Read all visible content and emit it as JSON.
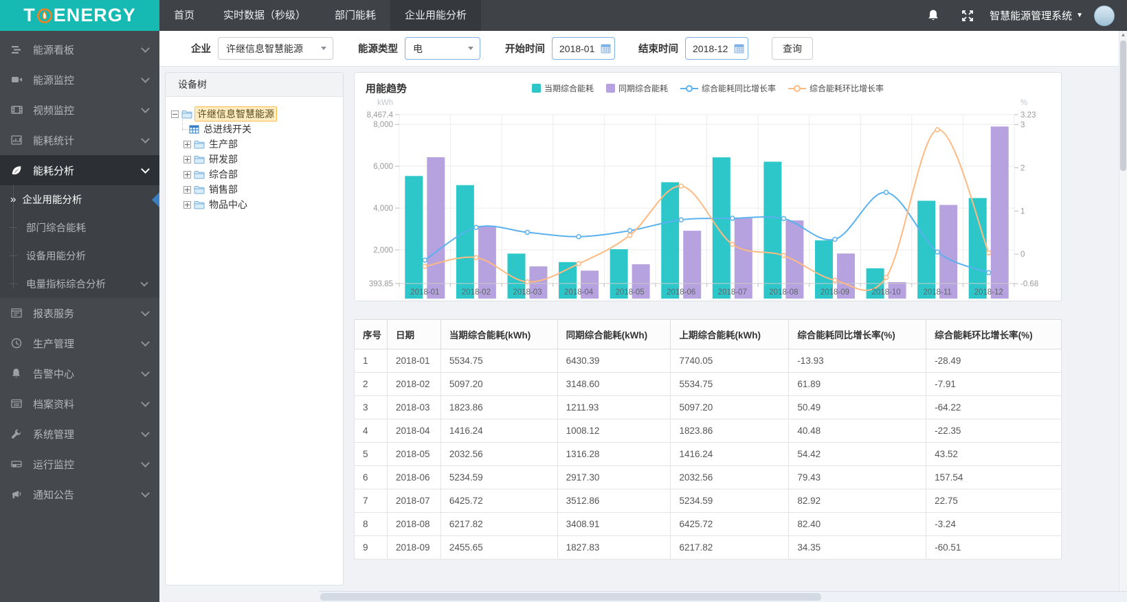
{
  "topbar": {
    "logo": {
      "prefix": "T",
      "suffix": "ENERGY",
      "at_icon": "flame-at-icon"
    },
    "nav": [
      {
        "label": "首页",
        "active": false
      },
      {
        "label": "实时数据（秒级）",
        "active": false
      },
      {
        "label": "部门能耗",
        "active": false
      },
      {
        "label": "企业用能分析",
        "active": true
      }
    ],
    "system_menu": {
      "label": "智慧能源管理系统"
    }
  },
  "sidebar": {
    "items": [
      {
        "label": "能源看板",
        "icon": "dashboard-icon"
      },
      {
        "label": "能源监控",
        "icon": "camera-icon"
      },
      {
        "label": "视频监控",
        "icon": "film-icon"
      },
      {
        "label": "能耗统计",
        "icon": "barchart-icon"
      },
      {
        "label": "能耗分析",
        "icon": "leaf-icon",
        "active": true,
        "expanded": true,
        "children": [
          {
            "label": "企业用能分析",
            "active": true
          },
          {
            "label": "部门综合能耗"
          },
          {
            "label": "设备用能分析"
          },
          {
            "label": "电量指标综合分析",
            "has_children": true
          }
        ]
      },
      {
        "label": "报表服务",
        "icon": "report-icon"
      },
      {
        "label": "生产管理",
        "icon": "clock-icon"
      },
      {
        "label": "告警中心",
        "icon": "bell-icon"
      },
      {
        "label": "档案资料",
        "icon": "archive-icon"
      },
      {
        "label": "系统管理",
        "icon": "wrench-icon"
      },
      {
        "label": "运行监控",
        "icon": "monitor-icon"
      },
      {
        "label": "通知公告",
        "icon": "megaphone-icon"
      }
    ]
  },
  "filters": {
    "company_label": "企业",
    "company_value": "许继信息智慧能源",
    "energy_type_label": "能源类型",
    "energy_type_value": "电",
    "start_label": "开始时间",
    "start_value": "2018-01",
    "end_label": "结束时间",
    "end_value": "2018-12",
    "query_label": "查询"
  },
  "tree": {
    "title": "设备树",
    "nodes": [
      {
        "label": "许继信息智慧能源",
        "icon": "folder-icon",
        "expander": "minus",
        "selected": true,
        "level": 0
      },
      {
        "label": "总进线开关",
        "icon": "meter-table-icon",
        "level": 1,
        "leaf": true
      },
      {
        "label": "生产部",
        "icon": "folder-icon",
        "expander": "plus",
        "level": 1
      },
      {
        "label": "研发部",
        "icon": "folder-icon",
        "expander": "plus",
        "level": 1
      },
      {
        "label": "综合部",
        "icon": "folder-icon",
        "expander": "plus",
        "level": 1
      },
      {
        "label": "销售部",
        "icon": "folder-icon",
        "expander": "plus",
        "level": 1
      },
      {
        "label": "物品中心",
        "icon": "folder-icon",
        "expander": "plus",
        "level": 1
      }
    ]
  },
  "chart": {
    "title": "用能趋势"
  },
  "chart_data": {
    "type": "bar+line",
    "title": "用能趋势",
    "categories": [
      "2018-01",
      "2018-02",
      "2018-03",
      "2018-04",
      "2018-05",
      "2018-06",
      "2018-07",
      "2018-08",
      "2018-09",
      "2018-10",
      "2018-11",
      "2018-12"
    ],
    "series": [
      {
        "name": "当期综合能耗",
        "type": "bar",
        "axis": "left",
        "color": "#2ec7c9",
        "values": [
          5534.75,
          5097.2,
          1823.86,
          1416.24,
          2032.56,
          5234.59,
          6425.72,
          6217.82,
          2455.65,
          1120,
          4350,
          4480
        ]
      },
      {
        "name": "同期综合能耗",
        "type": "bar",
        "axis": "left",
        "color": "#b6a2de",
        "values": [
          6430.39,
          3148.6,
          1211.93,
          1008.12,
          1316.28,
          2917.3,
          3512.86,
          3408.91,
          1827.83,
          460,
          4150,
          7900
        ]
      },
      {
        "name": "综合能耗同比增长率",
        "type": "line",
        "axis": "right",
        "color": "#5ab1ef",
        "values": [
          -0.1393,
          0.6189,
          0.5049,
          0.4048,
          0.5442,
          0.7943,
          0.8292,
          0.824,
          0.3435,
          1.43,
          0.05,
          -0.43
        ]
      },
      {
        "name": "综合能耗环比增长率",
        "type": "line",
        "axis": "right",
        "color": "#ffb980",
        "values": [
          -0.2849,
          -0.0791,
          -0.6422,
          -0.2235,
          0.4352,
          1.5754,
          0.2275,
          -0.0324,
          -0.6051,
          -0.54,
          2.88,
          0.03
        ]
      }
    ],
    "yaxis_left": {
      "unit": "kWh",
      "min": 393.85,
      "max": 8467.4,
      "ticks": [
        {
          "v": 8467.4,
          "label": "8,467.4"
        },
        {
          "v": 8000,
          "label": "8,000"
        },
        {
          "v": 6000,
          "label": "6,000"
        },
        {
          "v": 4000,
          "label": "4,000"
        },
        {
          "v": 2000,
          "label": "2,000"
        },
        {
          "v": 393.85,
          "label": "393.85"
        }
      ]
    },
    "yaxis_right": {
      "unit": "%",
      "min": -0.68,
      "max": 3.23,
      "ticks": [
        {
          "v": 3.23,
          "label": "3.23"
        },
        {
          "v": 3,
          "label": "3"
        },
        {
          "v": 2,
          "label": "2"
        },
        {
          "v": 1,
          "label": "1"
        },
        {
          "v": 0,
          "label": "0"
        },
        {
          "v": -0.68,
          "label": "-0.68"
        }
      ]
    },
    "grid": true,
    "legend_position": "top-center"
  },
  "table": {
    "headers": [
      "序号",
      "日期",
      "当期综合能耗(kWh)",
      "同期综合能耗(kWh)",
      "上期综合能耗(kWh)",
      "综合能耗同比增长率(%)",
      "综合能耗环比增长率(%)"
    ],
    "rows": [
      [
        "1",
        "2018-01",
        "5534.75",
        "6430.39",
        "7740.05",
        "-13.93",
        "-28.49"
      ],
      [
        "2",
        "2018-02",
        "5097.20",
        "3148.60",
        "5534.75",
        "61.89",
        "-7.91"
      ],
      [
        "3",
        "2018-03",
        "1823.86",
        "1211.93",
        "5097.20",
        "50.49",
        "-64.22"
      ],
      [
        "4",
        "2018-04",
        "1416.24",
        "1008.12",
        "1823.86",
        "40.48",
        "-22.35"
      ],
      [
        "5",
        "2018-05",
        "2032.56",
        "1316.28",
        "1416.24",
        "54.42",
        "43.52"
      ],
      [
        "6",
        "2018-06",
        "5234.59",
        "2917.30",
        "2032.56",
        "79.43",
        "157.54"
      ],
      [
        "7",
        "2018-07",
        "6425.72",
        "3512.86",
        "5234.59",
        "82.92",
        "22.75"
      ],
      [
        "8",
        "2018-08",
        "6217.82",
        "3408.91",
        "6425.72",
        "82.40",
        "-3.24"
      ],
      [
        "9",
        "2018-09",
        "2455.65",
        "1827.83",
        "6217.82",
        "34.35",
        "-60.51"
      ]
    ]
  },
  "colors": {
    "brand_teal": "#17b9b3",
    "bar_current": "#2ec7c9",
    "bar_same": "#b6a2de",
    "line_yoy": "#5ab1ef",
    "line_mom": "#ffb980"
  }
}
